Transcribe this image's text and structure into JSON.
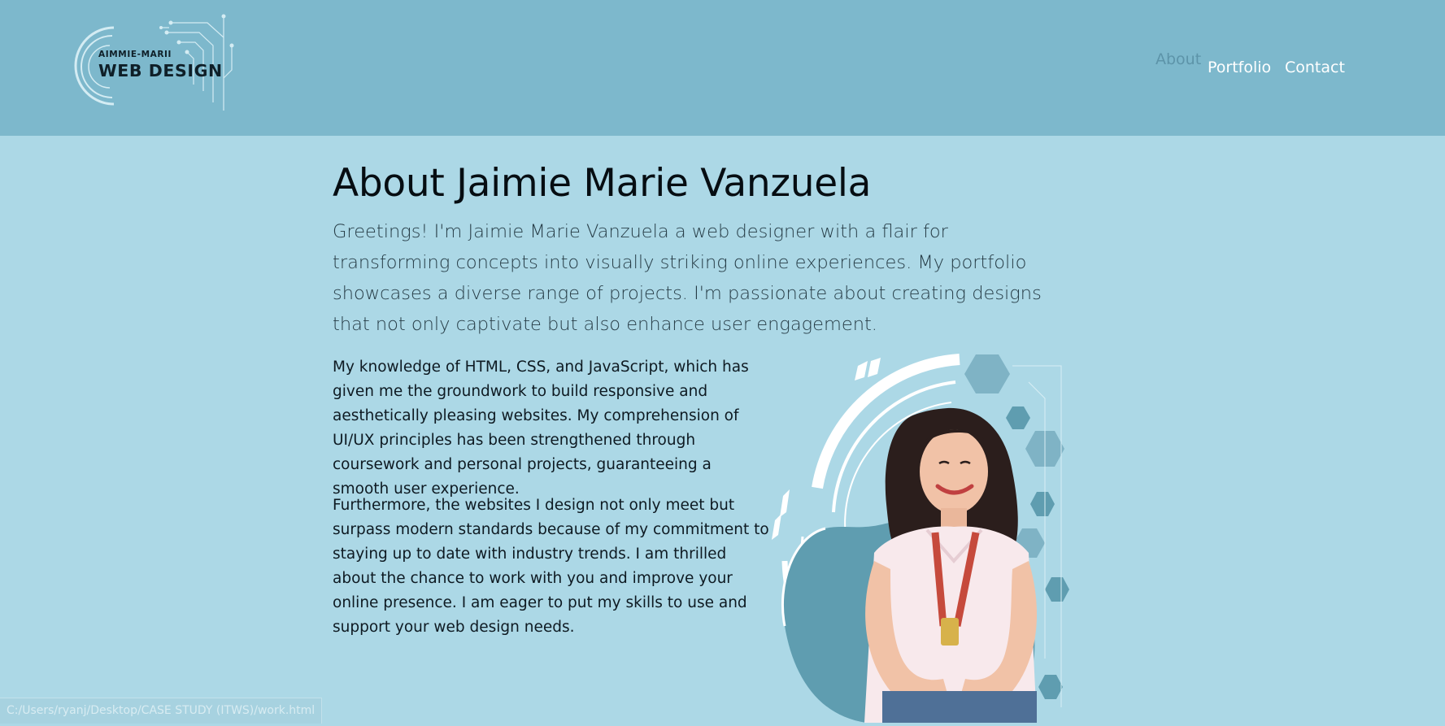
{
  "header": {
    "logo": {
      "small_text": "AIMMIE-MARII",
      "big_text": "WEB DESIGN"
    },
    "nav": [
      {
        "label": "About"
      },
      {
        "label": "Portfolio"
      },
      {
        "label": "Contact"
      }
    ]
  },
  "main": {
    "title": "About Jaimie Marie Vanzuela",
    "lead": "Greetings! I'm Jaimie Marie Vanzuela a web designer with a flair for transforming concepts into visually striking online experiences. My portfolio showcases a diverse range of projects. I'm passionate about creating designs that not only captivate but also enhance user engagement.",
    "paragraphs": [
      "My knowledge of HTML, CSS, and JavaScript, which has given me the groundwork to build responsive and aesthetically pleasing websites. My comprehension of UI/UX principles has been strengthened through coursework and personal projects, guaranteeing a smooth user experience.",
      "Furthermore, the websites I design not only meet but surpass modern standards because of my commitment to staying up to date with industry trends. I am thrilled about the chance to work with you and improve your online presence. I am eager to put my skills to use and support your web design needs."
    ]
  },
  "status_bar": {
    "url": "C:/Users/ryanj/Desktop/CASE STUDY (ITWS)/work.html"
  },
  "colors": {
    "header_bg": "#7db8cc",
    "page_bg": "#acd8e6",
    "nav_active": "#5d94a9",
    "nav_text": "#ffffff",
    "accent_hex": "#5f9db0"
  }
}
